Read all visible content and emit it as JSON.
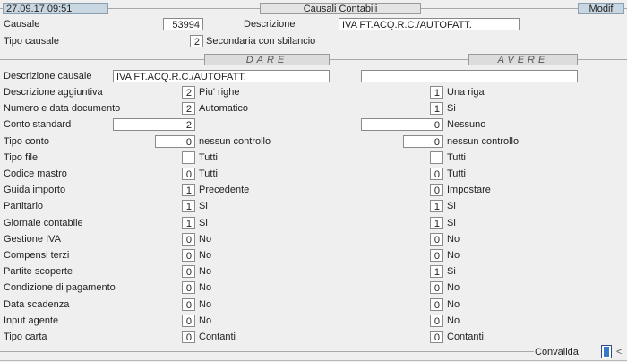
{
  "header": {
    "datetime": "27.09.17 09:51",
    "title": "Causali Contabili",
    "mode": "Modif"
  },
  "top": {
    "causale_label": "Causale",
    "causale_value": "53994",
    "descrizione_label": "Descrizione",
    "descrizione_value": "IVA FT.ACQ.R.C./AUTOFATT.",
    "tipo_label": "Tipo causale",
    "tipo_value": "2",
    "tipo_text": "Secondaria con sbilancio"
  },
  "sections": {
    "dare": "DARE",
    "avere": "AVERE"
  },
  "desc_causale": {
    "label": "Descrizione causale",
    "dare": "IVA FT.ACQ.R.C./AUTOFATT.",
    "avere": ""
  },
  "rows": [
    {
      "label": "Descrizione aggiuntiva",
      "dare_value": "2",
      "dare_text": "Piu' righe",
      "avere_value": "1",
      "avere_text": "Una riga"
    },
    {
      "label": "Numero e data documento",
      "dare_value": "2",
      "dare_text": "Automatico",
      "avere_value": "1",
      "avere_text": "Si"
    },
    {
      "label": "Conto standard",
      "dare_value": "2",
      "dare_text": "",
      "avere_value": "0",
      "avere_text": "Nessuno"
    },
    {
      "label": "Tipo conto",
      "dare_value": "0",
      "dare_text": "nessun controllo",
      "avere_value": "0",
      "avere_text": "nessun controllo"
    },
    {
      "label": "Tipo file",
      "dare_value": "",
      "dare_text": "Tutti",
      "avere_value": "",
      "avere_text": "Tutti"
    },
    {
      "label": "Codice mastro",
      "dare_value": "0",
      "dare_text": "Tutti",
      "avere_value": "0",
      "avere_text": "Tutti"
    },
    {
      "label": "Guida importo",
      "dare_value": "1",
      "dare_text": "Precedente",
      "avere_value": "0",
      "avere_text": "Impostare"
    },
    {
      "label": "Partitario",
      "dare_value": "1",
      "dare_text": "Si",
      "avere_value": "1",
      "avere_text": "Si"
    },
    {
      "label": "Giornale contabile",
      "dare_value": "1",
      "dare_text": "Si",
      "avere_value": "1",
      "avere_text": "Si"
    },
    {
      "label": "Gestione IVA",
      "dare_value": "0",
      "dare_text": "No",
      "avere_value": "0",
      "avere_text": "No"
    },
    {
      "label": "Compensi terzi",
      "dare_value": "0",
      "dare_text": "No",
      "avere_value": "0",
      "avere_text": "No"
    },
    {
      "label": "Partite scoperte",
      "dare_value": "0",
      "dare_text": "No",
      "avere_value": "1",
      "avere_text": "Si"
    },
    {
      "label": "Condizione di pagamento",
      "dare_value": "0",
      "dare_text": "No",
      "avere_value": "0",
      "avere_text": "No"
    },
    {
      "label": "Data scadenza",
      "dare_value": "0",
      "dare_text": "No",
      "avere_value": "0",
      "avere_text": "No"
    },
    {
      "label": "Input agente",
      "dare_value": "0",
      "dare_text": "No",
      "avere_value": "0",
      "avere_text": "No"
    },
    {
      "label": "Tipo carta",
      "dare_value": "0",
      "dare_text": "Contanti",
      "avere_value": "0",
      "avere_text": "Contanti"
    }
  ],
  "footer": {
    "convalida_label": "Convalida",
    "arrow": "<"
  }
}
